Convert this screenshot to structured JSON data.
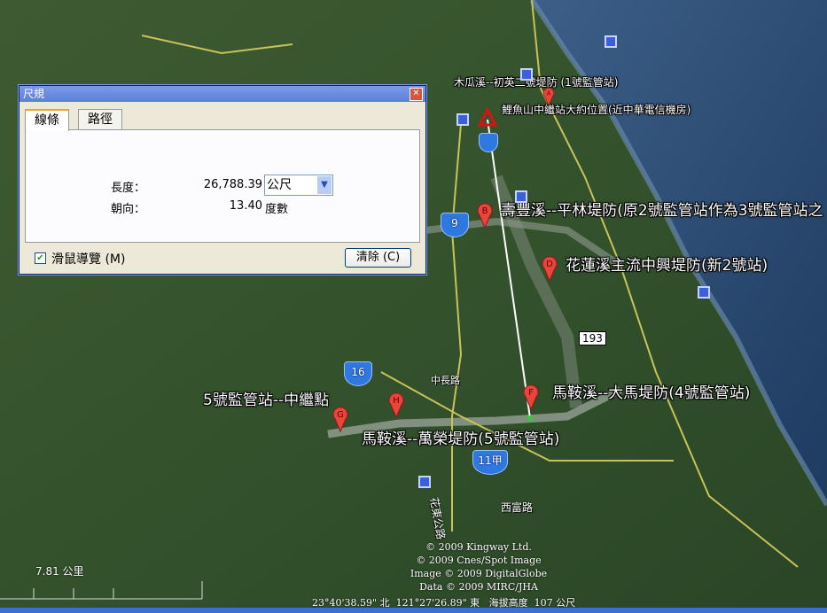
{
  "dialog": {
    "title": "尺規",
    "close_icon": "close-icon",
    "tabs": [
      {
        "label": "線條",
        "active": true
      },
      {
        "label": "路徑",
        "active": false
      }
    ],
    "length_label": "長度：",
    "length_value": "26,788.39",
    "length_unit": "公尺",
    "heading_label": "朝向：",
    "heading_value": "13.40",
    "heading_unit": "度數",
    "mouse_nav_label": "滑鼠導覽 (M)",
    "mouse_nav_checked": true,
    "clear_button": "清除 (C)"
  },
  "placemarks": [
    {
      "letter": "A",
      "label": "木瓜溪--初英二號堤防 (1號監管站)"
    },
    {
      "letter": "B",
      "label": "壽豐溪--平林堤防(原2號監管站作為3號監管站之"
    },
    {
      "letter": "D",
      "label": "花蓮溪主流中興堤防(新2號站)"
    },
    {
      "letter": "F",
      "label": "馬鞍溪--大馬堤防(4號監管站)"
    },
    {
      "letter": "G",
      "label": "5號監管站--中繼點"
    },
    {
      "letter": "H",
      "label": "馬鞍溪--萬榮堤防(5號監管站)"
    }
  ],
  "ruler_start_label": "鯉魚山中繼站大約位置(近中華電信機房)",
  "routes": [
    "9",
    "16",
    "11甲",
    "193"
  ],
  "roads": [
    "中長路",
    "西富路",
    "花東公路"
  ],
  "scale_label": "7.81 公里",
  "credits": [
    "© 2009 Kingway Ltd.",
    "© 2009 Cnes/Spot Image",
    "Image © 2009 DigitalGlobe",
    "Data © 2009 MIRC/JHA"
  ],
  "status": {
    "lat": "23°40'38.59\" 北",
    "lon": "121°27'26.89\" 東",
    "elev_label": "海拔高度",
    "elev_value": "107 公尺"
  },
  "colors": {
    "ocean": "#2c4f78",
    "land": "#3a5a30",
    "pin": "#e8453c",
    "ruler_line": "#ffffff"
  }
}
